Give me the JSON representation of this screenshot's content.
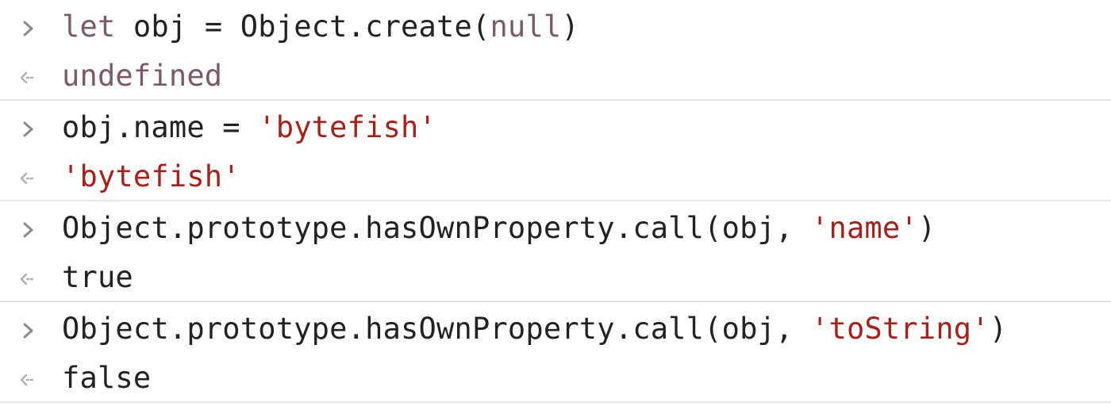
{
  "console": {
    "entries": [
      {
        "input": {
          "kw_let": "let",
          "mid": " obj = Object.create(",
          "kw_null": "null",
          "end": ")"
        },
        "output": "undefined"
      },
      {
        "input": {
          "pre": "obj.name = ",
          "str": "'bytefish'"
        },
        "output": "'bytefish'"
      },
      {
        "input": {
          "pre": "Object.prototype.hasOwnProperty.call(obj, ",
          "str": "'name'",
          "end": ")"
        },
        "output": "true"
      },
      {
        "input": {
          "pre": "Object.prototype.hasOwnProperty.call(obj, ",
          "str": "'toString'",
          "end": ")"
        },
        "output": "false"
      }
    ]
  },
  "icons": {
    "prompt": "chevron-right-icon",
    "result": "return-arrow-icon"
  },
  "colors": {
    "keyword": "#7a5a6a",
    "string": "#a8201a",
    "text": "#222222",
    "divider": "#e4e4e4",
    "icon": "#9a9a9a"
  }
}
